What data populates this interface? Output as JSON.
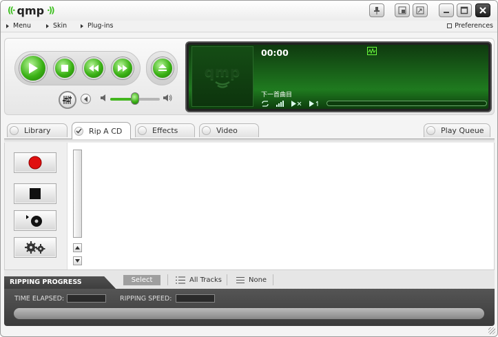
{
  "app": {
    "name": "qmp",
    "logo_waves_left": "((·",
    "logo_waves_right": "·))"
  },
  "titlebar": {
    "buttons": [
      {
        "name": "pin-icon"
      },
      {
        "name": "compact-mode-icon"
      },
      {
        "name": "mini-mode-icon"
      },
      {
        "name": "minimize-icon"
      },
      {
        "name": "maximize-icon"
      },
      {
        "name": "close-icon"
      }
    ]
  },
  "menubar": {
    "items": [
      {
        "label": "Menu"
      },
      {
        "label": "Skin"
      },
      {
        "label": "Plug-ins"
      }
    ],
    "preferences_label": "Preferences"
  },
  "player": {
    "time": "00:00",
    "track_title": "下一首曲目",
    "art_text": "qmp",
    "volume_fraction": 0.5,
    "seek_fraction": 0.0,
    "controls": [
      "play-icon",
      "stop-icon",
      "rewind-icon",
      "fast-forward-icon",
      "eject-icon"
    ],
    "lcd_controls": [
      "repeat-icon",
      "signal-icon",
      "mute-icon",
      "next-one-icon"
    ]
  },
  "tabs": [
    {
      "label": "Library",
      "active": false
    },
    {
      "label": "Rip A CD",
      "active": true
    },
    {
      "label": "Effects",
      "active": false
    },
    {
      "label": "Video",
      "active": false
    }
  ],
  "play_queue_label": "Play Queue",
  "rip_buttons": [
    "record-icon",
    "stop-square-icon",
    "cd-play-icon",
    "settings-gears-icon"
  ],
  "selection": {
    "ripping_progress_label": "RIPPING PROGRESS",
    "select_label": "Select",
    "all_tracks_label": "All Tracks",
    "none_label": "None"
  },
  "progress": {
    "time_elapsed_label": "TIME ELAPSED:",
    "ripping_speed_label": "RIPPING SPEED:",
    "time_elapsed_value": "",
    "ripping_speed_value": "",
    "progress_fraction": 0.0
  }
}
